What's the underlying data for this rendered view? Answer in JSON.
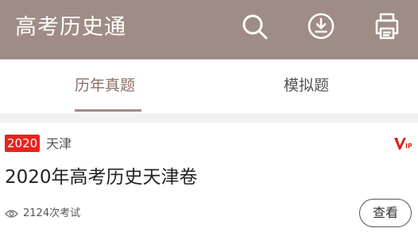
{
  "app": {
    "title": "高考历史通"
  },
  "header": {
    "icons": [
      "search-icon",
      "download-icon",
      "print-icon"
    ],
    "background_color": "#a08c86"
  },
  "tabs": [
    {
      "label": "历年真题",
      "active": true
    },
    {
      "label": "模拟题",
      "active": false
    }
  ],
  "exam_list": [
    {
      "year_badge": "2020",
      "region": "天津",
      "vip": true,
      "title": "2020年高考历史天津卷",
      "views": "2124次考试",
      "action_label": "查看"
    }
  ],
  "colors": {
    "accent": "#a08c86",
    "year_badge": "#e8231d",
    "vip": "#d6231c"
  }
}
